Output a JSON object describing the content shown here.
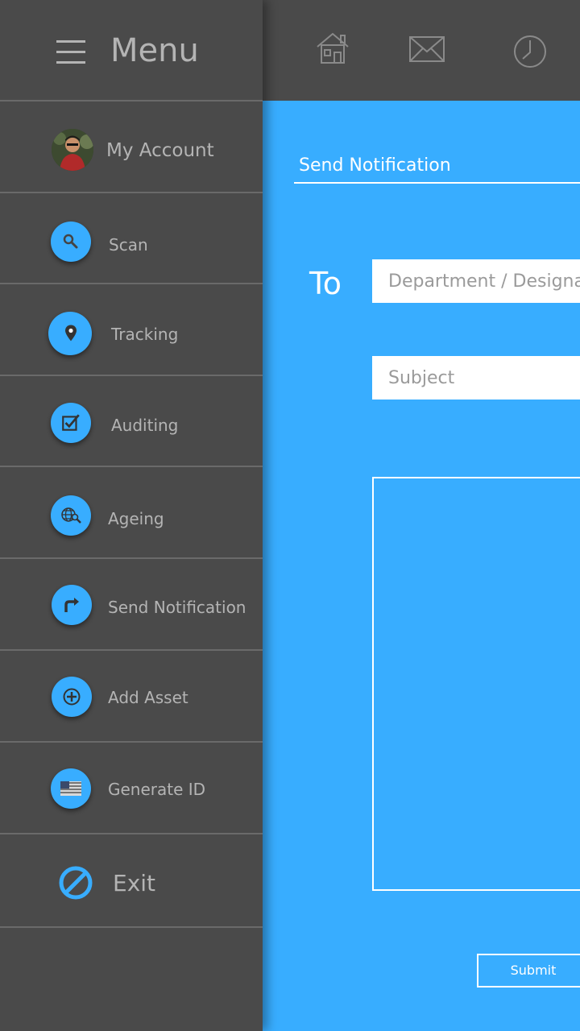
{
  "menu": {
    "title": "Menu",
    "account_label": "My Account",
    "items": [
      {
        "label": "Scan",
        "icon": "search-icon"
      },
      {
        "label": "Tracking",
        "icon": "map-pin-icon"
      },
      {
        "label": "Auditing",
        "icon": "checkbox-icon"
      },
      {
        "label": "Ageing",
        "icon": "globe-search-icon"
      },
      {
        "label": "Send Notification",
        "icon": "forward-arrow-icon"
      },
      {
        "label": "Add Asset",
        "icon": "plus-circle-icon"
      },
      {
        "label": "Generate ID",
        "icon": "flag-icon"
      }
    ],
    "exit_label": "Exit"
  },
  "topbar": {
    "icons": [
      "home-icon",
      "mail-icon",
      "clock-icon"
    ]
  },
  "form": {
    "title": "Send Notification",
    "to_label": "To",
    "to_placeholder": "Department / Designation",
    "subject_placeholder": "Subject",
    "submit_label": "Submit"
  },
  "colors": {
    "accent": "#38adff",
    "background": "#4a4a4a",
    "text_muted": "#b4b4b4"
  }
}
